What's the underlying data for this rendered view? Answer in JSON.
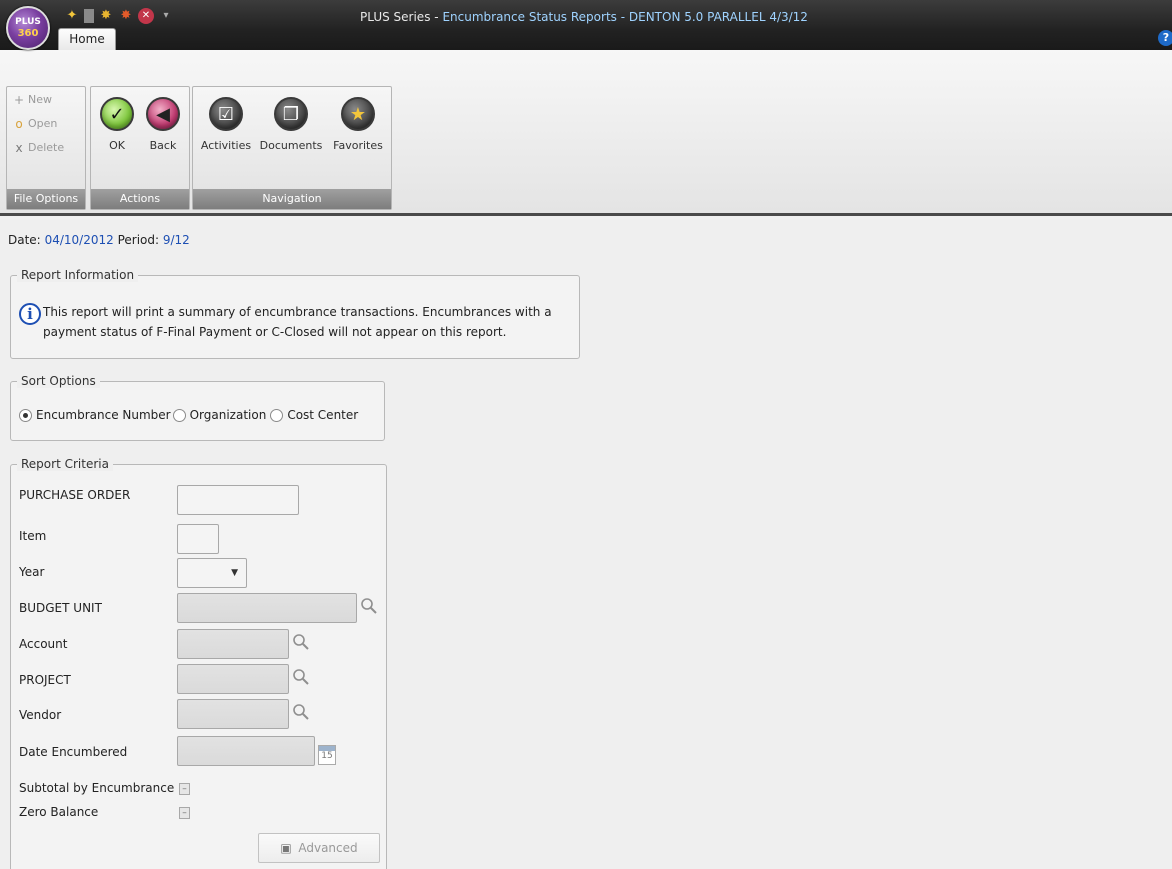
{
  "window": {
    "app_name": "PLUS Series",
    "title_rest": "Encumbrance Status Reports - DENTON 5.0 PARALLEL 4/3/12",
    "orb_top": "PLUS",
    "orb_bottom": "360",
    "help_glyph": "?"
  },
  "ribbon": {
    "tabs": [
      {
        "label": "Home"
      }
    ],
    "groups": {
      "file_options": {
        "label": "File Options",
        "items": [
          {
            "label": "New",
            "icon": "plus-icon",
            "glyph": "+"
          },
          {
            "label": "Open",
            "icon": "open-icon",
            "glyph": "o"
          },
          {
            "label": "Delete",
            "icon": "delete-icon",
            "glyph": "x"
          }
        ]
      },
      "actions": {
        "label": "Actions",
        "items": [
          {
            "label": "OK",
            "icon": "check-icon",
            "glyph": "✓"
          },
          {
            "label": "Back",
            "icon": "back-arrow-icon",
            "glyph": "◀"
          }
        ]
      },
      "navigation": {
        "label": "Navigation",
        "items": [
          {
            "label": "Activities",
            "icon": "activities-icon",
            "glyph": "☑"
          },
          {
            "label": "Documents",
            "icon": "documents-icon",
            "glyph": "❐"
          },
          {
            "label": "Favorites",
            "icon": "star-icon",
            "glyph": "★"
          }
        ]
      }
    }
  },
  "status": {
    "date_label": "Date:",
    "date_value": "04/10/2012",
    "period_label": "Period:",
    "period_value": "9/12"
  },
  "report_info": {
    "legend": "Report Information",
    "info_glyph": "i",
    "line1": "This report will print a summary of encumbrance transactions.  Encumbrances with a",
    "line2": "payment status of F-Final Payment or C-Closed will not appear on this report."
  },
  "sort_options": {
    "legend": "Sort Options",
    "options": [
      {
        "label": "Encumbrance Number",
        "selected": true
      },
      {
        "label": "Organization",
        "selected": false
      },
      {
        "label": "Cost Center",
        "selected": false
      }
    ]
  },
  "criteria": {
    "legend": "Report Criteria",
    "purchase_order": {
      "label": "PURCHASE ORDER",
      "value": ""
    },
    "item": {
      "label": "Item",
      "value": ""
    },
    "year": {
      "label": "Year",
      "value": ""
    },
    "budget_unit": {
      "label": "BUDGET UNIT",
      "value": ""
    },
    "account": {
      "label": "Account",
      "value": ""
    },
    "project": {
      "label": "PROJECT",
      "value": ""
    },
    "vendor": {
      "label": "Vendor",
      "value": ""
    },
    "date_encumbered": {
      "label": "Date Encumbered",
      "value": "",
      "calendar_day": "15"
    },
    "subtotal": {
      "label": "Subtotal by Encumbrance",
      "state": "–"
    },
    "zero_balance": {
      "label": "Zero Balance",
      "state": "–"
    },
    "advanced_label": "Advanced"
  }
}
